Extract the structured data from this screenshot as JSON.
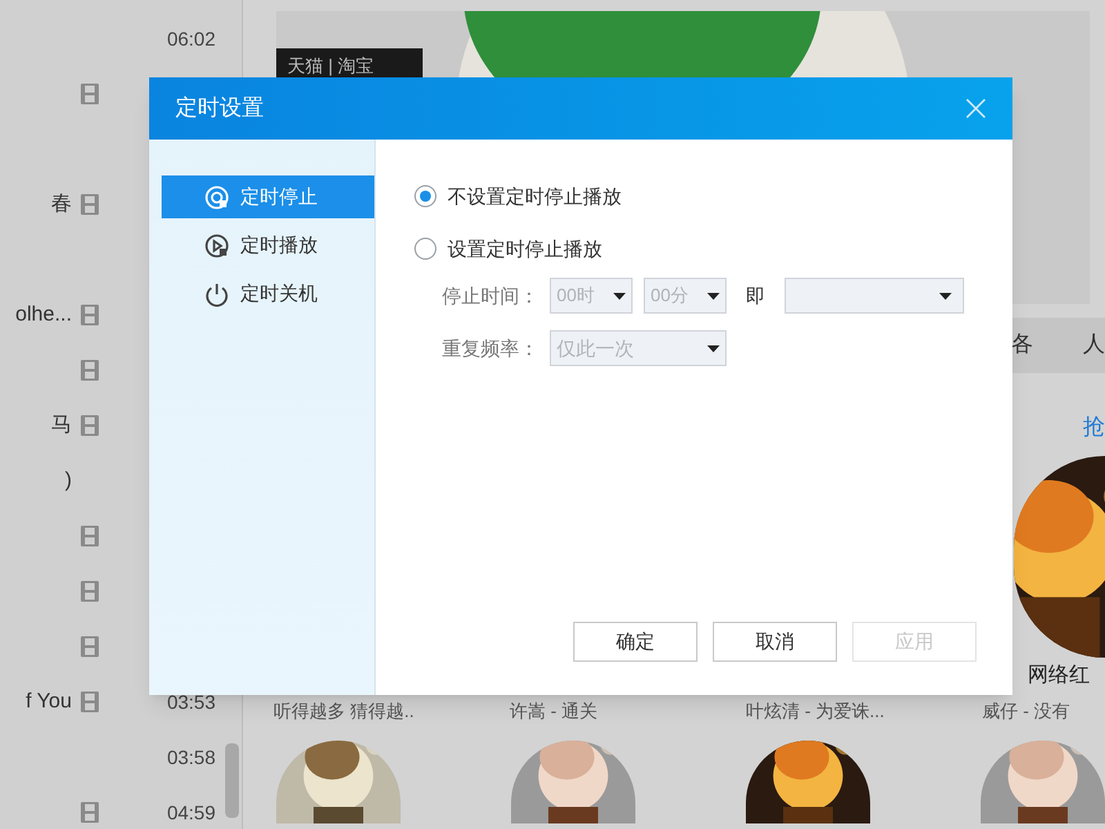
{
  "background": {
    "playlist": [
      {
        "video": false,
        "duration": "06:02"
      },
      {
        "video": true
      },
      {
        "video": false
      },
      {
        "title": "春",
        "video": true
      },
      {
        "video": false
      },
      {
        "title": "olhe...",
        "video": true
      },
      {
        "video": true
      },
      {
        "title": "马",
        "video": true
      },
      {
        "title": ")",
        "video": false
      },
      {
        "video": true
      },
      {
        "video": true
      },
      {
        "video": true
      },
      {
        "title": "f You",
        "video": true,
        "duration": "03:53"
      },
      {
        "video": false,
        "duration": "03:58"
      },
      {
        "video": true,
        "duration": "04:59"
      }
    ],
    "banner": {
      "badge": "天猫 | 淘宝"
    },
    "tabs": [
      "各",
      "人"
    ],
    "more_link": "抢",
    "card_title": "网络红",
    "captions": [
      "听得越多 猜得越..",
      "许嵩 - 通关",
      "叶炫清 - 为爱诛...",
      "威仔 - 没有"
    ]
  },
  "dialog": {
    "title": "定时设置",
    "sidebar": [
      {
        "label": "定时停止",
        "kind": "stop",
        "selected": true
      },
      {
        "label": "定时播放",
        "kind": "play",
        "selected": false
      },
      {
        "label": "定时关机",
        "kind": "power",
        "selected": false
      }
    ],
    "options": [
      {
        "label": "不设置定时停止播放",
        "selected": true
      },
      {
        "label": "设置定时停止播放",
        "selected": false
      }
    ],
    "stop_time": {
      "label": "停止时间：",
      "hour": "00时",
      "minute": "00分",
      "joiner": "即",
      "disabled": true
    },
    "repeat": {
      "label": "重复频率：",
      "value": "仅此一次",
      "disabled": true
    },
    "buttons": [
      {
        "label": "确定",
        "disabled": false
      },
      {
        "label": "取消",
        "disabled": false
      },
      {
        "label": "应用",
        "disabled": true
      }
    ]
  }
}
